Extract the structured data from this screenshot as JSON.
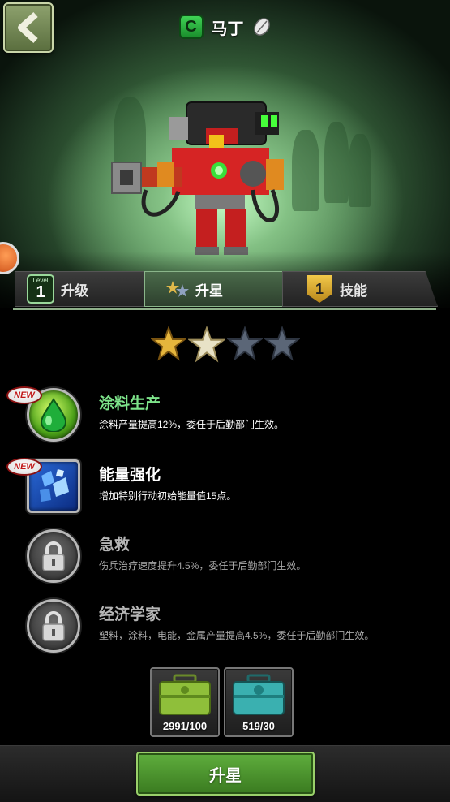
{
  "header": {
    "rank_letter": "C",
    "hero_name": "马丁"
  },
  "tabs": [
    {
      "label": "升级",
      "badge_small": "Level",
      "badge_num": "1"
    },
    {
      "label": "升星"
    },
    {
      "label": "技能",
      "badge_num": "1"
    }
  ],
  "stars": {
    "earned": 2,
    "total": 4
  },
  "skills": [
    {
      "new_badge": "NEW",
      "title": "涂料生产",
      "desc": "涂料产量提高12%，委任于后勤部门生效。",
      "icon": "green-drop-icon",
      "state": "unlocked"
    },
    {
      "new_badge": "NEW",
      "title": "能量强化",
      "desc": "增加特别行动初始能量值15点。",
      "icon": "blue-crystal-icon",
      "state": "unlocked"
    },
    {
      "title": "急救",
      "desc": "伤兵治疗速度提升4.5%，委任于后勤部门生效。",
      "icon": "lock-icon",
      "state": "locked"
    },
    {
      "title": "经济学家",
      "desc": "塑料，涂料，电能，金属产量提高4.5%，委任于后勤部门生效。",
      "icon": "lock-icon",
      "state": "locked"
    }
  ],
  "resources": [
    {
      "count": "2991/100",
      "icon": "green-case-icon"
    },
    {
      "count": "519/30",
      "icon": "teal-case-icon"
    }
  ],
  "action": {
    "upgrade_label": "升星"
  },
  "colors": {
    "accent_green": "#7de38a",
    "button_green": "#4e9a2f"
  }
}
